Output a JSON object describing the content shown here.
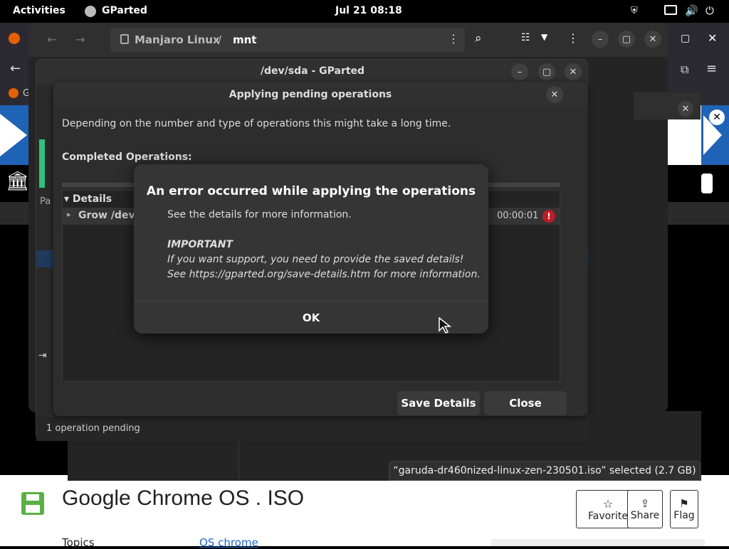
{
  "topbar": {
    "activities": "Activities",
    "app_name": "GParted",
    "clock": "Jul 21  08:18"
  },
  "files": {
    "path_root": "Manjaro Linux",
    "path_sep": "/",
    "path_current": "mnt"
  },
  "gparted": {
    "title": "/dev/sda - GParted",
    "status": "1 operation pending",
    "side_tab": "Pa"
  },
  "apply_dialog": {
    "title": "Applying pending operations",
    "description": "Depending on the number and type of operations this might take a long time.",
    "completed_label": "Completed Operations:",
    "details_label": "Details",
    "op_row_label": "Grow /dev/",
    "op_row_time": "00:00:01",
    "save_details": "Save Details",
    "close": "Close"
  },
  "error_dialog": {
    "title": "An error occurred while applying the operations",
    "line1": "See the details for more information.",
    "important": "IMPORTANT",
    "line2": "If you want support, you need to provide the saved details!",
    "line3": "See https://gparted.org/save-details.htm for more information.",
    "ok": "OK"
  },
  "status_toast": {
    "text": "“garuda-dr460nized-linux-zen-230501.iso” selected  (2.7 GB)"
  },
  "web": {
    "tab_partial": "Ge",
    "page_title": "Google Chrome OS . ISO",
    "topics_label": "Topics",
    "topics_link": "OS chrome",
    "favorite": "Favorite",
    "share": "Share",
    "flag": "Flag"
  },
  "colors": {
    "error_red": "#c01c28",
    "progress_green": "#2ec27e",
    "archive_blue": "#1f63b6",
    "save_green": "#5bb043"
  }
}
